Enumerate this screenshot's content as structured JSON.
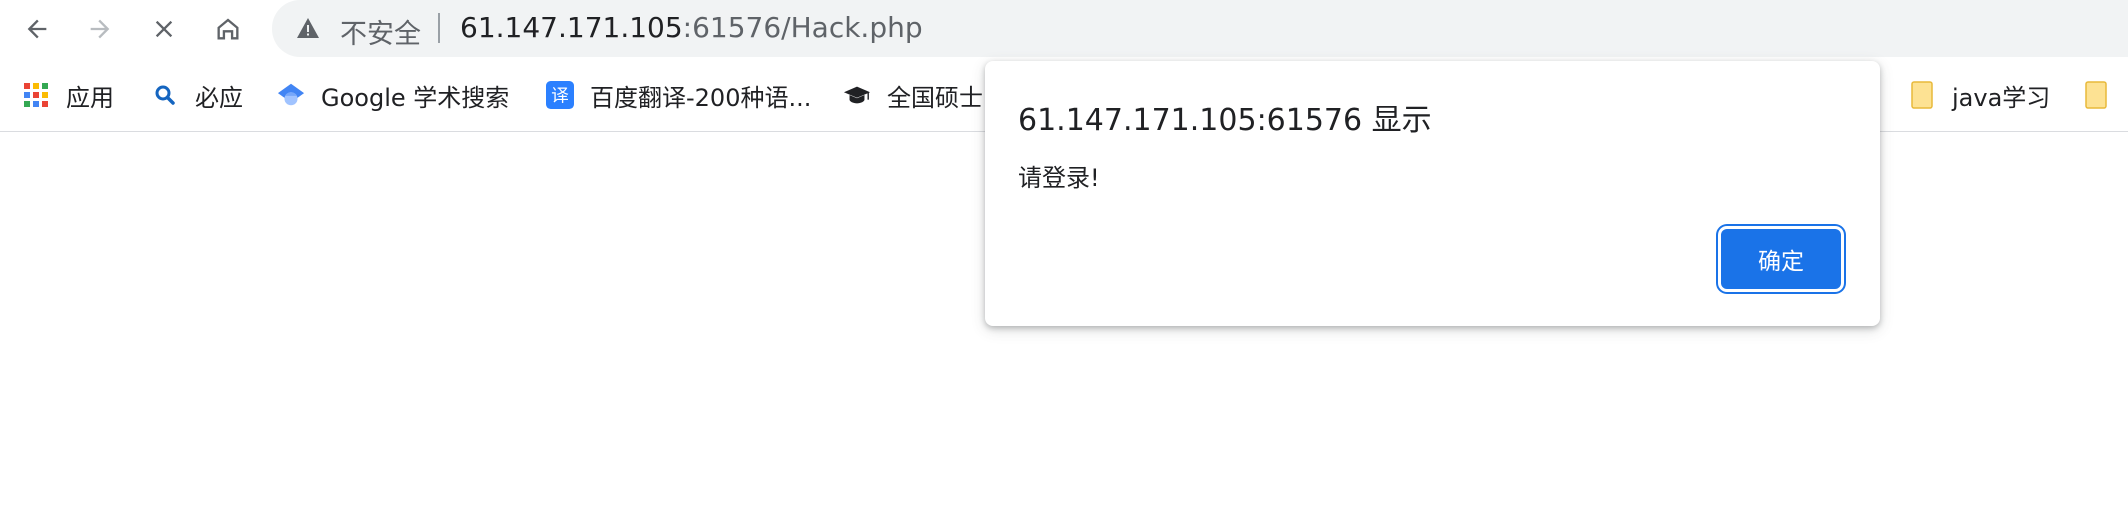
{
  "toolbar": {
    "icons": [
      "back-icon",
      "forward-icon",
      "stop-icon",
      "home-icon"
    ]
  },
  "omnibox": {
    "security_label": "不安全",
    "url_host": "61.147.171.105",
    "url_rest": ":61576/Hack.php"
  },
  "bookmarks": {
    "items": [
      {
        "label": "应用",
        "icon": "apps-grid-icon"
      },
      {
        "label": "必应",
        "icon": "bing-search-icon"
      },
      {
        "label": "Google 学术搜索",
        "icon": "google-scholar-icon"
      },
      {
        "label": "百度翻译-200种语...",
        "icon": "baidu-translate-icon"
      },
      {
        "label": "全国硕士",
        "icon": "graduation-cap-icon"
      },
      {
        "label": "java学习",
        "icon": "folder-icon"
      }
    ]
  },
  "dialog": {
    "title": "61.147.171.105:61576 显示",
    "message": "请登录!",
    "ok_label": "确定"
  },
  "colors": {
    "accent": "#1a73e8",
    "omnibox_bg": "#f1f3f4",
    "folder": "#fde293"
  }
}
